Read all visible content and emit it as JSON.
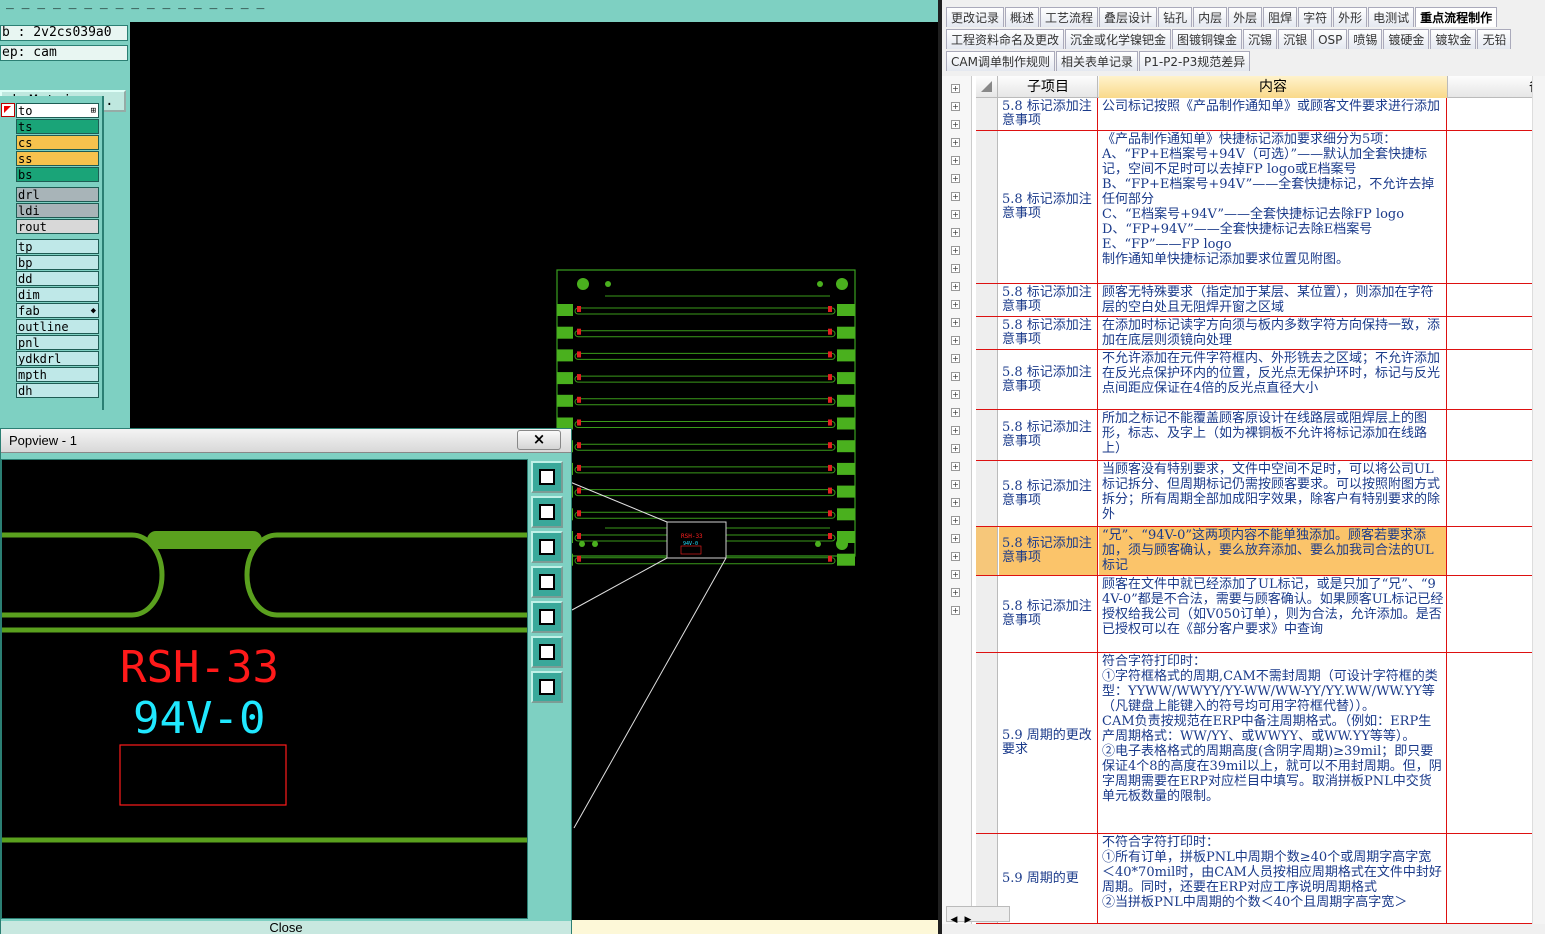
{
  "cam": {
    "title_fragment": "_ _ _ _  _ _  _ _ _ _ _  _ _ _ _ _ _",
    "job_label": "b : 2v2cs039a0",
    "step_label": "ep: cam",
    "job_matrix": "ob Matrix ...",
    "layers": [
      {
        "name": "to",
        "color": "#ffffff",
        "mark": "⊞"
      },
      {
        "name": "ts",
        "color": "#1aa478"
      },
      {
        "name": "cs",
        "color": "#f7c24d"
      },
      {
        "name": "ss",
        "color": "#f7c24d"
      },
      {
        "name": "bs",
        "color": "#1aa478"
      },
      {
        "name": "drl",
        "color": "#a8b4b8"
      },
      {
        "name": "ldi",
        "color": "#a8b4b8"
      },
      {
        "name": "rout",
        "color": "#d8d8d8"
      },
      {
        "name": "tp",
        "color": "#bfe8e8"
      },
      {
        "name": "bp",
        "color": "#bfe8e8"
      },
      {
        "name": "dd",
        "color": "#bfe8e8"
      },
      {
        "name": "dim",
        "color": "#bfe8e8"
      },
      {
        "name": "fab",
        "color": "#bfe8e8",
        "mark": "◆"
      },
      {
        "name": "outline",
        "color": "#bfe8e8"
      },
      {
        "name": "pnl",
        "color": "#bfe8e8"
      },
      {
        "name": "ydkdrl",
        "color": "#bfe8e8"
      },
      {
        "name": "mpth",
        "color": "#bfe8e8"
      },
      {
        "name": "dh",
        "color": "#bfe8e8"
      }
    ],
    "popview": {
      "title": "Popview - 1",
      "close_glyph": "×",
      "close_label": "Close",
      "marking_text": "RSH-33",
      "ul_text": "94V-0"
    },
    "board_label_1": "RSH-33",
    "board_label_2": "94V-0"
  },
  "doc": {
    "tab_rows": [
      [
        "更改记录",
        "概述",
        "工艺流程",
        "叠层设计",
        "钻孔",
        "内层",
        "外层",
        "阻焊",
        "字符",
        "外形",
        "电测试",
        "重点流程制作"
      ],
      [
        "工程资料命名及更改",
        "沉金或化学镍钯金",
        "图镀铜镍金",
        "沉锡",
        "沉银",
        "OSP",
        "喷锡",
        "镀硬金",
        "镀软金",
        "无铅"
      ],
      [
        "CAM调单制作规则",
        "相关表单记录",
        "P1-P2-P3规范差异"
      ]
    ],
    "active_tab": "重点流程制作",
    "columns": [
      "子项目",
      "内容",
      "备"
    ],
    "rows": [
      {
        "sub": "5.8 标记添加注意事项",
        "content": "公司标记按照《产品制作通知单》或顾客文件要求进行添加"
      },
      {
        "sub": "5.8 标记添加注意事项",
        "content": "《产品制作通知单》快捷标记添加要求细分为5项：\nA、“FP+E档案号+94V（可选）”——默认加全套快捷标记，空间不足时可以去掉FP logo或E档案号\nB、“FP+E档案号+94V”——全套快捷标记，不允许去掉任何部分\nC、“E档案号+94V”——全套快捷标记去除FP logo\nD、“FP+94V”——全套快捷标记去除E档案号\nE、“FP”——FP logo\n制作通知单快捷标记添加要求位置见附图。"
      },
      {
        "sub": "5.8 标记添加注意事项",
        "content": "顾客无特殊要求（指定加于某层、某位置），则添加在字符层的空白处且无阻焊开窗之区域"
      },
      {
        "sub": "5.8 标记添加注意事项",
        "content": "在添加时标记读字方向须与板内多数字符方向保持一致，添加在底层则须镜向处理"
      },
      {
        "sub": "5.8 标记添加注意事项",
        "content": "不允许添加在元件字符框内、外形铣去之区域；不允许添加在反光点保护环内的位置，反光点无保护环时，标记与反光点间距应保证在4倍的反光点直径大小"
      },
      {
        "sub": "5.8 标记添加注意事项",
        "content": "所加之标记不能覆盖顾客原设计在线路层或阻焊层上的图形，标志、及字上（如为裸铜板不允许将标记添加在线路上）"
      },
      {
        "sub": "5.8 标记添加注意事项",
        "content": "当顾客没有特别要求，文件中空间不足时，可以将公司UL标记拆分、但周期标记仍需按顾客要求。可以按照附图方式拆分；所有周期全部加成阳字效果，除客户有特别要求的除外"
      },
      {
        "sub": "5.8 标记添加注意事项",
        "content": "“兄”、“94V-0”这两项内容不能单独添加。顾客若要求添加，须与顾客确认，要么放弃添加、要么加我司合法的UL标记",
        "highlight": true
      },
      {
        "sub": "5.8 标记添加注意事项",
        "content": "顾客在文件中就已经添加了UL标记，或是只加了“兄”、“94V-0”都是不合法，需要与顾客确认。如果顾客UL标记已经授权给我公司（如V050订单），则为合法，允许添加。是否已授权可以在《部分客户要求》中查询"
      },
      {
        "sub": "5.9 周期的更改要求",
        "content": "符合字符打印时：\n①字符框格式的周期,CAM不需封周期（可设计字符框的类型：YYWW/WWYY/YY-WW/WW-YY/YY.WW/WW.YY等（凡键盘上能键入的符号均可用字符框代替））。\nCAM负责按规范在ERP中备注周期格式。（例如：ERP生产周期格式：WW/YY、或WWYY、或WW.YY等等）。\n②电子表格格式的周期高度(含阴字周期)≥39mil；即只要保证4个8的高度在39mil以上，就可以不用封周期。但，阴字周期需要在ERP对应栏目中填写。取消拼板PNL中交货单元板数量的限制。"
      },
      {
        "sub": "5.9 周期的更",
        "content": "不符合字符打印时：\n①所有订单，拼板PNL中周期个数≥40个或周期字高字宽＜40*70mil时，由CAM人员按相应周期格式在文件中封好周期。同时，还要在ERP对应工序说明周期格式\n②当拼板PNL中周期的个数＜40个且周期字高字宽＞"
      }
    ]
  }
}
